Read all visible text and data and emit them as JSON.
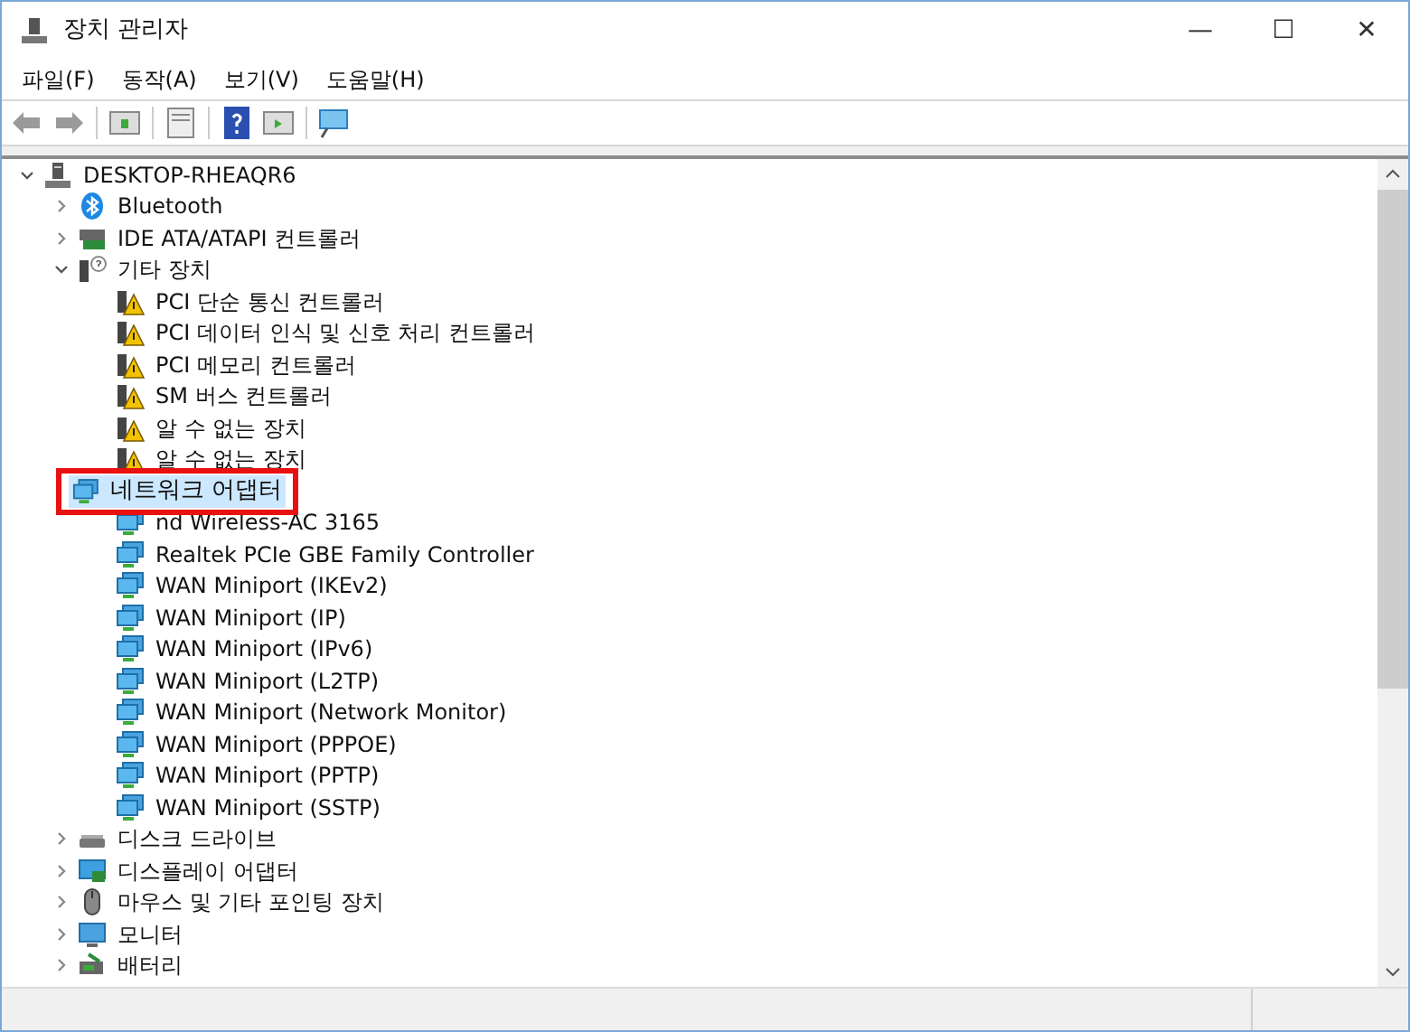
{
  "window": {
    "title": "장치 관리자",
    "controls": [
      "—",
      "☐",
      "✕"
    ]
  },
  "menu": [
    "파일(F)",
    "동작(A)",
    "보기(V)",
    "도움말(H)"
  ],
  "tree": {
    "label": "DESKTOP-RHEAQR6",
    "expanded": true,
    "selected": false,
    "children": [
      {
        "label": "Bluetooth",
        "expanded": false,
        "selected": false
      },
      {
        "label": "IDE ATA/ATAPI 컨트롤러",
        "expanded": false,
        "selected": false
      },
      {
        "label": "기타 장치",
        "expanded": true,
        "selected": false,
        "children": [
          {
            "label": "PCI 단순 통신 컨트롤러",
            "warning": true,
            "selected": false
          },
          {
            "label": "PCI 데이터 인식 및 신호 처리 컨트롤러",
            "warning": true,
            "selected": false
          },
          {
            "label": "PCI 메모리 컨트롤러",
            "warning": true,
            "selected": false
          },
          {
            "label": "SM 버스 컨트롤러",
            "warning": true,
            "selected": false
          },
          {
            "label": "알 수 없는 장치",
            "warning": true,
            "selected": false
          },
          {
            "label": "알 수 없는 장치",
            "warning": true,
            "selected": false
          }
        ]
      },
      {
        "label": "네트워크 어댑터",
        "expanded": true,
        "selected": true,
        "callout": true,
        "children": [
          {
            "label": "nd Wireless-AC 3165",
            "warning": false,
            "selected": false
          },
          {
            "label": "Realtek PCIe GBE Family Controller",
            "warning": false,
            "selected": false
          },
          {
            "label": "WAN Miniport (IKEv2)",
            "warning": false,
            "selected": false
          },
          {
            "label": "WAN Miniport (IP)",
            "warning": false,
            "selected": false
          },
          {
            "label": "WAN Miniport (IPv6)",
            "warning": false,
            "selected": false
          },
          {
            "label": "WAN Miniport (L2TP)",
            "warning": false,
            "selected": false
          },
          {
            "label": "WAN Miniport (Network Monitor)",
            "warning": false,
            "selected": false
          },
          {
            "label": "WAN Miniport (PPPOE)",
            "warning": false,
            "selected": false
          },
          {
            "label": "WAN Miniport (PPTP)",
            "warning": false,
            "selected": false
          },
          {
            "label": "WAN Miniport (SSTP)",
            "warning": false,
            "selected": false
          }
        ]
      },
      {
        "label": "디스크 드라이브",
        "expanded": false,
        "selected": false
      },
      {
        "label": "디스플레이 어댑터",
        "expanded": false,
        "selected": false
      },
      {
        "label": "마우스 및 기타 포인팅 장치",
        "expanded": false,
        "selected": false
      },
      {
        "label": "모니터",
        "expanded": false,
        "selected": false
      },
      {
        "label": "배터리",
        "expanded": false,
        "selected": false
      }
    ]
  }
}
